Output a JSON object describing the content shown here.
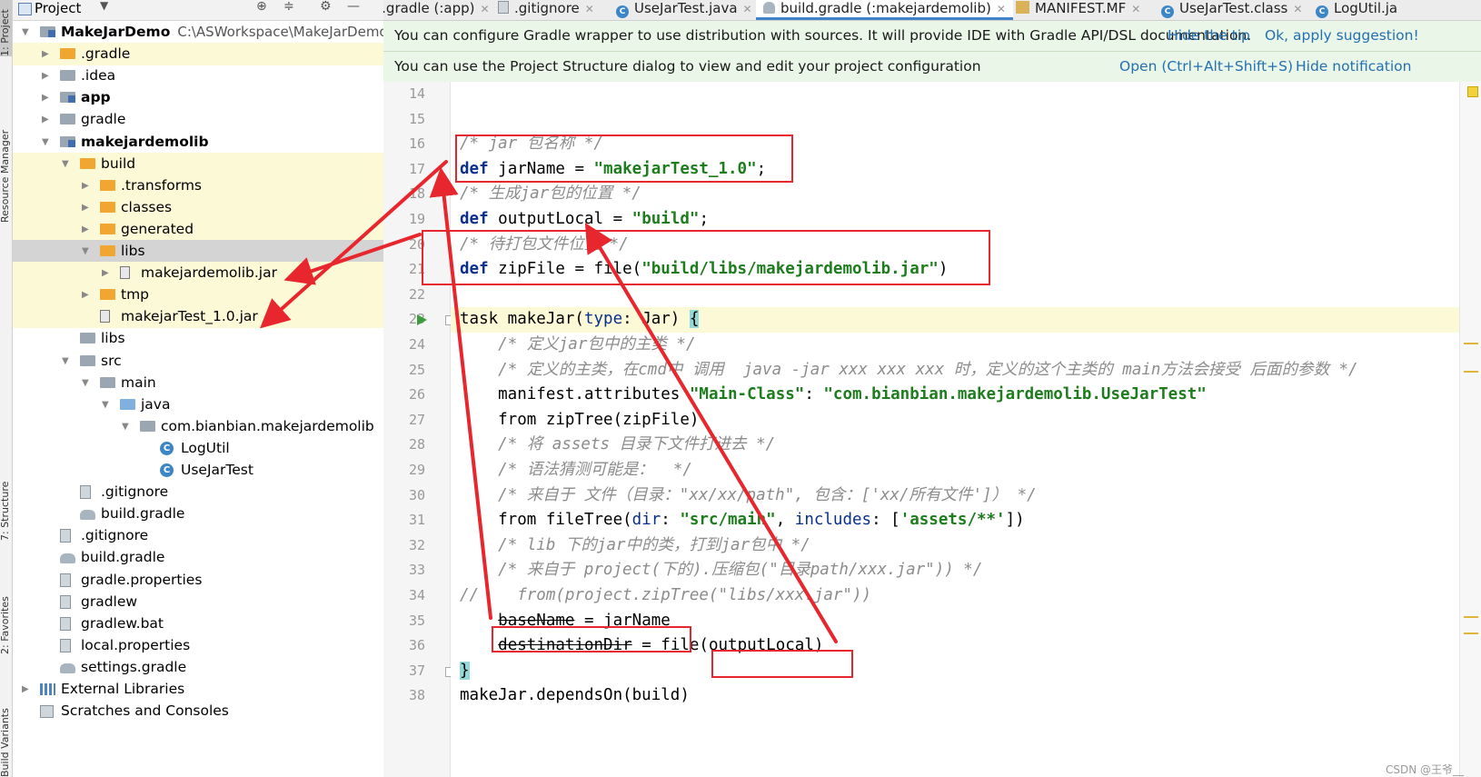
{
  "left_strip": {
    "tabs": [
      {
        "label": "1: Project",
        "active": true
      },
      {
        "label": "Resource Manager"
      },
      {
        "label": "7: Structure"
      },
      {
        "label": "2: Favorites"
      },
      {
        "label": "Build Variants"
      }
    ]
  },
  "project_panel": {
    "title": "Project",
    "tree": [
      {
        "label": "MakeJarDemo",
        "path": "C:\\ASWorkspace\\MakeJarDemo",
        "icon": "module-icon",
        "depth": 0,
        "expanded": true,
        "bold": true
      },
      {
        "label": ".gradle",
        "icon": "folder-orange-icon",
        "depth": 1,
        "expanded": false,
        "hl": true
      },
      {
        "label": ".idea",
        "icon": "folder-icon",
        "depth": 1,
        "expanded": false
      },
      {
        "label": "app",
        "icon": "module-icon",
        "depth": 1,
        "expanded": false,
        "bold": true
      },
      {
        "label": "gradle",
        "icon": "folder-icon",
        "depth": 1,
        "expanded": false
      },
      {
        "label": "makejardemolib",
        "icon": "module-icon",
        "depth": 1,
        "expanded": true,
        "bold": true
      },
      {
        "label": "build",
        "icon": "folder-orange-icon",
        "depth": 2,
        "expanded": true,
        "hl": true
      },
      {
        "label": ".transforms",
        "icon": "folder-orange-icon",
        "depth": 3,
        "expanded": false,
        "hl": true
      },
      {
        "label": "classes",
        "icon": "folder-orange-icon",
        "depth": 3,
        "expanded": false,
        "hl": true
      },
      {
        "label": "generated",
        "icon": "folder-orange-icon",
        "depth": 3,
        "expanded": false,
        "hl": true
      },
      {
        "label": "libs",
        "icon": "folder-orange-icon",
        "depth": 3,
        "expanded": true,
        "sel": true
      },
      {
        "label": "makejardemolib.jar",
        "icon": "jar-icon",
        "depth": 4,
        "expanded": false,
        "hl": true
      },
      {
        "label": "tmp",
        "icon": "folder-orange-icon",
        "depth": 3,
        "expanded": false,
        "hl": true
      },
      {
        "label": "makejarTest_1.0.jar",
        "icon": "jar-icon",
        "depth": 3,
        "leaf": true,
        "hl": true
      },
      {
        "label": "libs",
        "icon": "folder-icon",
        "depth": 2,
        "leaf": true
      },
      {
        "label": "src",
        "icon": "folder-icon",
        "depth": 2,
        "expanded": true
      },
      {
        "label": "main",
        "icon": "folder-icon",
        "depth": 3,
        "expanded": true
      },
      {
        "label": "java",
        "icon": "folder-blue-icon",
        "depth": 4,
        "expanded": true
      },
      {
        "label": "com.bianbian.makejardemolib",
        "icon": "package-icon",
        "depth": 5,
        "expanded": true
      },
      {
        "label": "LogUtil",
        "icon": "class-icon",
        "depth": 6,
        "leaf": true
      },
      {
        "label": "UseJarTest",
        "icon": "class-icon",
        "depth": 6,
        "leaf": true
      },
      {
        "label": ".gitignore",
        "icon": "file-icon",
        "depth": 2,
        "leaf": true
      },
      {
        "label": "build.gradle",
        "icon": "gradle-icon",
        "depth": 2,
        "leaf": true
      },
      {
        "label": ".gitignore",
        "icon": "file-icon",
        "depth": 1,
        "leaf": true
      },
      {
        "label": "build.gradle",
        "icon": "gradle-icon",
        "depth": 1,
        "leaf": true
      },
      {
        "label": "gradle.properties",
        "icon": "properties-icon",
        "depth": 1,
        "leaf": true
      },
      {
        "label": "gradlew",
        "icon": "file-icon",
        "depth": 1,
        "leaf": true
      },
      {
        "label": "gradlew.bat",
        "icon": "file-icon",
        "depth": 1,
        "leaf": true
      },
      {
        "label": "local.properties",
        "icon": "properties-icon",
        "depth": 1,
        "leaf": true
      },
      {
        "label": "settings.gradle",
        "icon": "gradle-icon",
        "depth": 1,
        "leaf": true
      },
      {
        "label": "External Libraries",
        "icon": "library-icon",
        "depth": 0,
        "expanded": false
      },
      {
        "label": "Scratches and Consoles",
        "icon": "scratch-icon",
        "depth": 0,
        "leaf": true
      }
    ]
  },
  "tabs": [
    {
      "label": "l.gradle (:app)",
      "icon": "gradle",
      "active": false
    },
    {
      "label": ".gitignore",
      "icon": "file",
      "active": false
    },
    {
      "label": "UseJarTest.java",
      "icon": "class",
      "active": false
    },
    {
      "label": "build.gradle (:makejardemolib)",
      "icon": "gradle",
      "active": true
    },
    {
      "label": "MANIFEST.MF",
      "icon": "mf",
      "active": false
    },
    {
      "label": "UseJarTest.class",
      "icon": "class",
      "active": false
    },
    {
      "label": "LogUtil.ja",
      "icon": "class",
      "active": false
    }
  ],
  "banners": [
    {
      "text": "You can configure Gradle wrapper to use distribution with sources. It will provide IDE with Gradle API/DSL documentation.",
      "links": [
        "Hide the tip",
        "Ok, apply suggestion!"
      ]
    },
    {
      "text": "You can use the Project Structure dialog to view and edit your project configuration",
      "links": [
        "Open (Ctrl+Alt+Shift+S)",
        "Hide notification"
      ]
    }
  ],
  "editor": {
    "line_numbers": [
      "14",
      "15",
      "16",
      "17",
      "18",
      "19",
      "20",
      "21",
      "22",
      "23",
      "24",
      "25",
      "26",
      "27",
      "28",
      "29",
      "30",
      "31",
      "32",
      "33",
      "34",
      "35",
      "36",
      "37",
      "38"
    ],
    "lines": [
      [],
      [],
      [
        [
          "cm",
          "/* jar 包名称 */"
        ]
      ],
      [
        [
          "kw",
          "def "
        ],
        [
          "",
          "jarName = "
        ],
        [
          "str",
          "\"makejarTest_1.0\""
        ],
        [
          "",
          ";"
        ]
      ],
      [
        [
          "cm",
          "/* 生成jar包的位置 */"
        ]
      ],
      [
        [
          "kw",
          "def "
        ],
        [
          "",
          "outputLocal = "
        ],
        [
          "str",
          "\"build\""
        ],
        [
          "",
          ";"
        ]
      ],
      [
        [
          "cm",
          "/* 待打包文件位置 */"
        ]
      ],
      [
        [
          "kw",
          "def "
        ],
        [
          "",
          "zipFile = file("
        ],
        [
          "str",
          "\"build/libs/makejardemolib.jar\""
        ],
        [
          "",
          ")"
        ]
      ],
      [],
      [
        [
          "",
          "task makeJar("
        ],
        [
          "prm",
          "type"
        ],
        [
          "",
          ": Jar) "
        ],
        [
          "brace",
          "{"
        ]
      ],
      [
        [
          "",
          "    "
        ],
        [
          "cm",
          "/* 定义jar包中的主类 */"
        ]
      ],
      [
        [
          "",
          "    "
        ],
        [
          "cm",
          "/* 定义的主类，在cmd中 调用  java -jar xxx xxx xxx 时，定义的这个主类的 main方法会接受 后面的参数 */"
        ]
      ],
      [
        [
          "",
          "    manifest.attributes "
        ],
        [
          "str",
          "\"Main-Class\""
        ],
        [
          "",
          ": "
        ],
        [
          "str",
          "\"com.bianbian.makejardemolib.UseJarTest\""
        ]
      ],
      [
        [
          "",
          "    from zipTree(zipFile)"
        ]
      ],
      [
        [
          "",
          "    "
        ],
        [
          "cm",
          "/* 将 assets 目录下文件打进去 */"
        ]
      ],
      [
        [
          "",
          "    "
        ],
        [
          "cm",
          "/* 语法猜测可能是：  */"
        ]
      ],
      [
        [
          "",
          "    "
        ],
        [
          "cm",
          "/* 来自于 文件（目录：\"xx/xx/path\", 包含：['xx/所有文件']） */"
        ]
      ],
      [
        [
          "",
          "    from fileTree("
        ],
        [
          "prm",
          "dir"
        ],
        [
          "",
          ": "
        ],
        [
          "str",
          "\"src/main\""
        ],
        [
          "",
          ", "
        ],
        [
          "prm",
          "includes"
        ],
        [
          "",
          ": ["
        ],
        [
          "str",
          "'assets/**'"
        ],
        [
          "",
          "])"
        ]
      ],
      [
        [
          "",
          "    "
        ],
        [
          "cm",
          "/* lib 下的jar中的类，打到jar包中 */"
        ]
      ],
      [
        [
          "",
          "    "
        ],
        [
          "cm",
          "/* 来自于 project(下的).压缩包(\"目录path/xxx.jar\")) */"
        ]
      ],
      [
        [
          "cm",
          "//    from(project.zipTree(\"libs/xxx.jar\"))"
        ]
      ],
      [
        [
          "",
          "    "
        ],
        [
          "strike",
          "baseName"
        ],
        [
          "",
          " = jarName"
        ]
      ],
      [
        [
          "",
          "    "
        ],
        [
          "strike",
          "destinationDir"
        ],
        [
          "",
          " = file(outputLocal)"
        ]
      ],
      [
        [
          "brace",
          "}"
        ]
      ],
      [
        [
          "",
          "makeJar.dependsOn(build)"
        ]
      ]
    ],
    "current_line": 23
  },
  "watermark": "CSDN @王爷__",
  "annotation_color": "#e8262d"
}
